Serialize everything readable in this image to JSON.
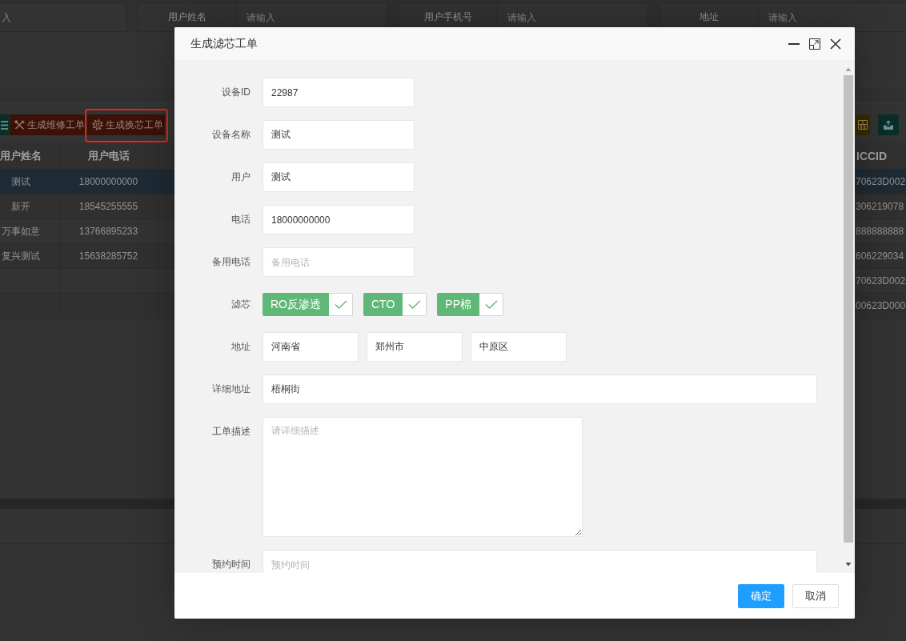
{
  "search_bar": {
    "fields": [
      {
        "placeholder": "入"
      },
      {
        "label": "用户姓名",
        "placeholder": "请输入"
      },
      {
        "label": "用户手机号",
        "placeholder": "请输入"
      },
      {
        "label": "地址",
        "placeholder": "请输入"
      }
    ]
  },
  "toolbar": {
    "left_buttons": [
      {
        "kind": "list",
        "highlighted": false
      },
      {
        "kind": "repair",
        "label": "生成维修工单",
        "highlighted": false
      },
      {
        "kind": "filter",
        "label": "生成换芯工单",
        "highlighted": true
      }
    ],
    "right_buttons": [
      {
        "kind": "columns",
        "highlighted": false
      },
      {
        "kind": "export",
        "highlighted": false
      }
    ]
  },
  "table": {
    "columns": [
      "用户姓名",
      "用户电话",
      "ICCID"
    ],
    "rows": [
      {
        "selected": true,
        "user_name": "测试",
        "user_phone": "18000000000",
        "iccid": "70623D002"
      },
      {
        "selected": false,
        "user_name": "新开",
        "user_phone": "18545255555",
        "iccid": "306219078"
      },
      {
        "selected": false,
        "user_name": "万事如意",
        "user_phone": "13766895233",
        "iccid": "888888888"
      },
      {
        "selected": false,
        "user_name": "复兴测试",
        "user_phone": "15638285752",
        "iccid": "606229034"
      },
      {
        "selected": false,
        "iccid": "70623D002"
      },
      {
        "selected": false,
        "iccid": "00623D000"
      }
    ]
  },
  "dialog": {
    "title": "生成滤芯工单",
    "fields": [
      {
        "kind": "input",
        "label": "设备ID",
        "value": "22987"
      },
      {
        "kind": "input",
        "label": "设备名称",
        "value": "测试"
      },
      {
        "kind": "input",
        "label": "用户",
        "value": "测试"
      },
      {
        "kind": "input",
        "label": "电话",
        "value": "18000000000"
      },
      {
        "kind": "input",
        "label": "备用电话",
        "placeholder": "备用电话"
      },
      {
        "kind": "checkboxes",
        "label": "滤芯",
        "options": [
          {
            "label": "RO反渗透",
            "checked": true
          },
          {
            "label": "CTO",
            "checked": true
          },
          {
            "label": "PP棉",
            "checked": true
          }
        ]
      },
      {
        "kind": "address",
        "label": "地址",
        "values": [
          "河南省",
          "郑州市",
          "中原区"
        ]
      },
      {
        "kind": "wide_input",
        "label": "详细地址",
        "value": "梧桐街"
      },
      {
        "kind": "textarea",
        "label": "工单描述",
        "placeholder": "请详细描述"
      },
      {
        "kind": "wide_input",
        "label": "预约时间",
        "placeholder": "预约时间"
      }
    ],
    "buttons": [
      {
        "kind": "primary",
        "label": "确定"
      },
      {
        "kind": "default",
        "label": "取消"
      }
    ]
  }
}
